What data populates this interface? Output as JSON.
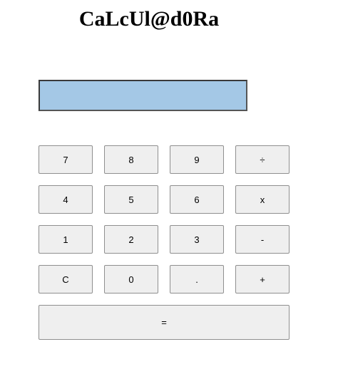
{
  "title": "CaLcUl@d0Ra",
  "display": {
    "value": ""
  },
  "keys": {
    "seven": "7",
    "eight": "8",
    "nine": "9",
    "divide": "÷",
    "four": "4",
    "five": "5",
    "six": "6",
    "multiply": "x",
    "one": "1",
    "two": "2",
    "three": "3",
    "minus": "-",
    "clear": "C",
    "zero": "0",
    "decimal": ".",
    "plus": "+",
    "equals": "="
  },
  "colors": {
    "display_background": "#a4c8e6",
    "key_background": "#efefef",
    "key_border": "#8f8f8f"
  }
}
